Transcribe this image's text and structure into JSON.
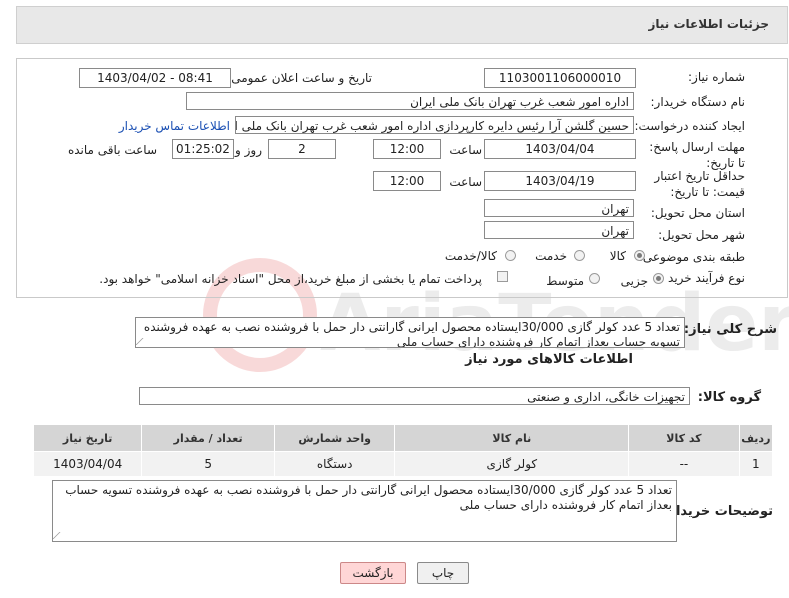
{
  "header": {
    "title": "جزئیات اطلاعات نیاز"
  },
  "form": {
    "need_number": {
      "label": "شماره نیاز:",
      "value": "1103001106000010"
    },
    "announce_date": {
      "label": "تاریخ و ساعت اعلان عمومی:",
      "value": "1403/04/02 - 08:41"
    },
    "buyer_org": {
      "label": "نام دستگاه خریدار:",
      "value": "اداره امور شعب غرب تهران بانک ملی ایران"
    },
    "requester": {
      "label": "ایجاد کننده درخواست:",
      "value": "حسین گلشن آرا رئیس دایره کارپردازی اداره امور شعب غرب تهران بانک ملی ایرا",
      "link": "اطلاعات تماس خریدار"
    },
    "reply_deadline": {
      "label": "مهلت ارسال پاسخ: تا تاریخ:",
      "date": "1403/04/04",
      "time_label": "ساعت",
      "time": "12:00",
      "days": "2",
      "days_label": "روز و",
      "remaining": "01:25:02",
      "remaining_label": "ساعت باقی مانده"
    },
    "price_validity": {
      "label": "حداقل تاریخ اعتبار قیمت: تا تاریخ:",
      "date": "1403/04/19",
      "time_label": "ساعت",
      "time": "12:00"
    },
    "province": {
      "label": "استان محل تحویل:",
      "value": "تهران"
    },
    "city": {
      "label": "شهر محل تحویل:",
      "value": "تهران"
    },
    "category": {
      "label": "طبقه بندی موضوعی:",
      "options": [
        "کالا",
        "خدمت",
        "کالا/خدمت"
      ],
      "selected": "کالا"
    },
    "purchase_type": {
      "label": "نوع فرآیند خرید :",
      "options": [
        "جزیی",
        "متوسط"
      ],
      "selected": "جزیی",
      "note": "پرداخت تمام یا بخشی از مبلغ خرید،از محل \"اسناد خزانه اسلامی\" خواهد بود."
    }
  },
  "description": {
    "label": "شرح کلی نیاز:",
    "value": "تعداد 5 عدد کولر گازی 30/000ایستاده محصول ایرانی گارانتی دار حمل با فروشنده نصب به عهده فروشنده تسویه حساب بعداز اتمام کار فروشنده دارای حساب ملی"
  },
  "goods_info": {
    "title": "اطلاعات کالاهای مورد نیاز"
  },
  "goods_group": {
    "label": "گروه کالا:",
    "value": "تجهیزات خانگی، اداری و صنعتی"
  },
  "table": {
    "headers": [
      "ردیف",
      "کد کالا",
      "نام کالا",
      "واحد شمارش",
      "تعداد / مقدار",
      "تاریخ نیاز"
    ],
    "rows": [
      [
        "1",
        "--",
        "کولر گازی",
        "دستگاه",
        "5",
        "1403/04/04"
      ]
    ]
  },
  "buyer_notes": {
    "label": "توضیحات خریدار:",
    "value": "تعداد 5 عدد کولر گازی 30/000ایستاده محصول ایرانی گارانتی دار حمل با فروشنده نصب به عهده فروشنده تسویه حساب بعداز اتمام کار فروشنده دارای حساب ملی"
  },
  "buttons": {
    "print": "چاپ",
    "back": "بازگشت"
  },
  "watermark": {
    "text": "AriaTender.neT"
  }
}
